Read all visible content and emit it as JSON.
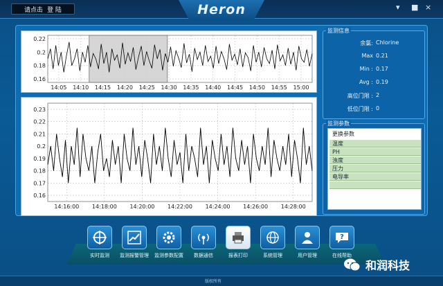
{
  "header": {
    "login_prompt": "请点击",
    "login_label": "登 陆",
    "logo": "Heron",
    "window_controls": [
      "▾",
      "■",
      "×"
    ]
  },
  "info_panel": {
    "title": "监测信息",
    "rows": [
      {
        "label": "余氯:",
        "value": "Chlorine"
      },
      {
        "label": "Max",
        "value": "0.21"
      },
      {
        "label": "Min :",
        "value": "0.17"
      },
      {
        "label": "Avg :",
        "value": "0.19"
      },
      {
        "label": "高位门限 :",
        "value": "2"
      },
      {
        "label": "低位门限 :",
        "value": "0"
      }
    ]
  },
  "params_panel": {
    "title": "监测参数",
    "header": "更换参数",
    "items": [
      "温度",
      "PH",
      "浊度",
      "压力",
      "电导率"
    ]
  },
  "toolbar": {
    "buttons": [
      {
        "label": "实时监测",
        "icon": "crosshair-icon"
      },
      {
        "label": "监测报警管理",
        "icon": "trend-chart-icon"
      },
      {
        "label": "监测参数配置",
        "icon": "gear-icon"
      },
      {
        "label": "数据通信",
        "icon": "signal-icon"
      },
      {
        "label": "报表打印",
        "icon": "printer-icon"
      },
      {
        "label": "系统管理",
        "icon": "globe-icon"
      },
      {
        "label": "用户管理",
        "icon": "user-icon"
      },
      {
        "label": "在线帮助",
        "icon": "help-icon"
      }
    ]
  },
  "status": {
    "text": "版权所有"
  },
  "watermark": {
    "text": "和润科技",
    "icon": "wechat-icon"
  },
  "colors": {
    "accent": "#0e6cb3",
    "panel_border": "#4aa2e0",
    "line": "#000000",
    "selection": "#d6d6d6",
    "param_row": "#c8e2c0"
  },
  "chart_data": [
    {
      "type": "line",
      "ylim": [
        0.155,
        0.225
      ],
      "yticks": [
        "0.22",
        "0.2",
        "0.18",
        "0.16"
      ],
      "xticks": [
        "14:05",
        "14:10",
        "14:15",
        "14:20",
        "14:25",
        "14:30",
        "14:35",
        "14:40",
        "14:45",
        "14:50",
        "14:55",
        "15:00"
      ],
      "selection_range": [
        "14:12",
        "14:29"
      ],
      "series": [
        {
          "values": [
            0.19,
            0.205,
            0.175,
            0.21,
            0.18,
            0.2,
            0.17,
            0.195,
            0.215,
            0.18,
            0.19,
            0.205,
            0.172,
            0.2,
            0.185,
            0.21,
            0.178,
            0.198,
            0.19,
            0.175,
            0.212,
            0.183,
            0.2,
            0.17,
            0.205,
            0.188,
            0.196,
            0.176,
            0.214,
            0.182,
            0.199,
            0.186,
            0.207,
            0.174,
            0.193,
            0.209,
            0.18,
            0.201,
            0.187,
            0.176,
            0.211,
            0.19,
            0.204,
            0.173,
            0.198,
            0.185,
            0.208,
            0.179,
            0.202,
            0.191,
            0.177,
            0.213,
            0.184,
            0.197,
            0.171,
            0.206,
            0.189,
            0.2,
            0.18,
            0.21,
            0.186,
            0.194,
            0.176,
            0.209,
            0.183,
            0.201,
            0.19,
            0.174,
            0.212,
            0.188,
            0.197,
            0.181,
            0.205,
            0.178,
            0.199,
            0.192,
            0.172,
            0.21,
            0.185,
            0.2,
            0.178,
            0.207,
            0.19,
            0.183,
            0.203,
            0.175,
            0.211,
            0.187,
            0.196,
            0.18,
            0.206,
            0.182,
            0.2,
            0.173,
            0.209,
            0.19,
            0.185,
            0.204,
            0.179,
            0.198
          ]
        }
      ]
    },
    {
      "type": "line",
      "ylim": [
        0.155,
        0.235
      ],
      "yticks": [
        "0.23",
        "0.22",
        "0.21",
        "0.2",
        "0.19",
        "0.18",
        "0.17",
        "0.16"
      ],
      "xticks": [
        "14:16:00",
        "14:18:00",
        "14:20:00",
        "14:22:00",
        "14:24:00",
        "14:26:00",
        "14:28:00"
      ],
      "series": [
        {
          "values": [
            0.185,
            0.2,
            0.18,
            0.21,
            0.19,
            0.175,
            0.205,
            0.17,
            0.2,
            0.185,
            0.215,
            0.175,
            0.21,
            0.19,
            0.18,
            0.2,
            0.17,
            0.195,
            0.21,
            0.18,
            0.19,
            0.175,
            0.205,
            0.185,
            0.2,
            0.17,
            0.21,
            0.19,
            0.18,
            0.215,
            0.185,
            0.2,
            0.175,
            0.205,
            0.19,
            0.17,
            0.21,
            0.185,
            0.2,
            0.18,
            0.215,
            0.19,
            0.175,
            0.205,
            0.185,
            0.195,
            0.17,
            0.21,
            0.18,
            0.2,
            0.19,
            0.175,
            0.215,
            0.185,
            0.2,
            0.17,
            0.205,
            0.19,
            0.18,
            0.21,
            0.185,
            0.2,
            0.175,
            0.215,
            0.19,
            0.18,
            0.205,
            0.185,
            0.2,
            0.17,
            0.21,
            0.19,
            0.18,
            0.2,
            0.185,
            0.215,
            0.175,
            0.205,
            0.19,
            0.18,
            0.2,
            0.185,
            0.21,
            0.175,
            0.205,
            0.19,
            0.17,
            0.215,
            0.185,
            0.2,
            0.18
          ]
        }
      ]
    }
  ]
}
